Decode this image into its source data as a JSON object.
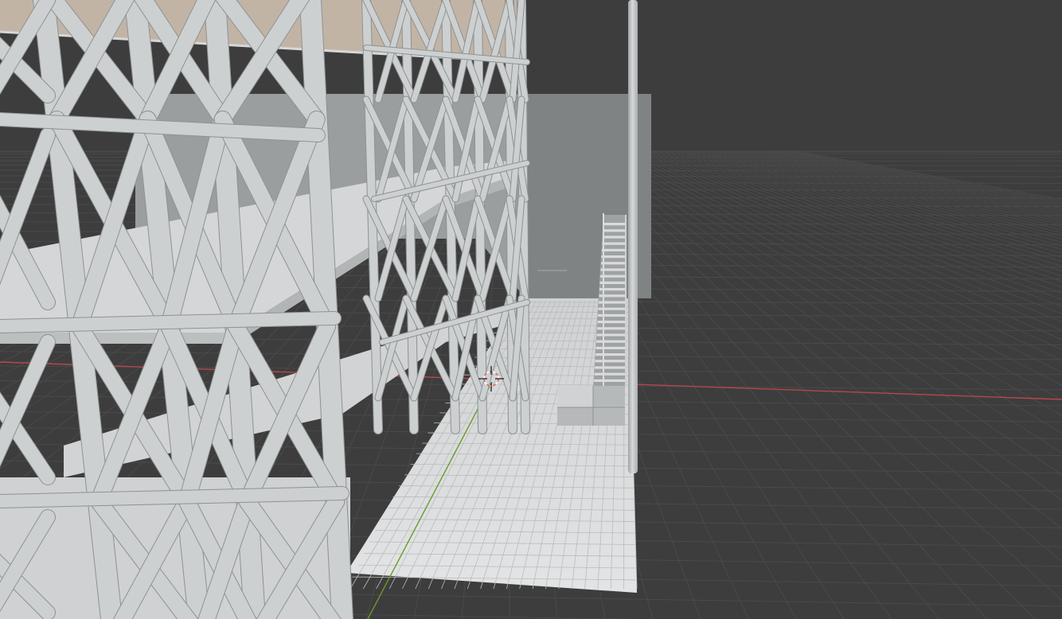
{
  "app": {
    "kind": "3D viewport",
    "view": "perspective"
  },
  "viewport": {
    "background_color": "#3d3d3d",
    "grid_line_color": "#4a4a4a",
    "x_axis_color": "#b8464c",
    "y_axis_color": "#6b9a2a"
  },
  "scene": {
    "objects": [
      "scaffolding-tower",
      "floor-slabs",
      "back-wall",
      "staircase",
      "stair-landing",
      "floor-grid-plane",
      "vertical-pole"
    ],
    "structure_color": "#c9cccd",
    "floor_color": "#d8dadb",
    "wall_color": "#8e9292",
    "roof_underside_color": "#c1b3a4"
  },
  "cursor": {
    "icon": "3d-cursor-icon",
    "ring_color": "#e06060"
  }
}
